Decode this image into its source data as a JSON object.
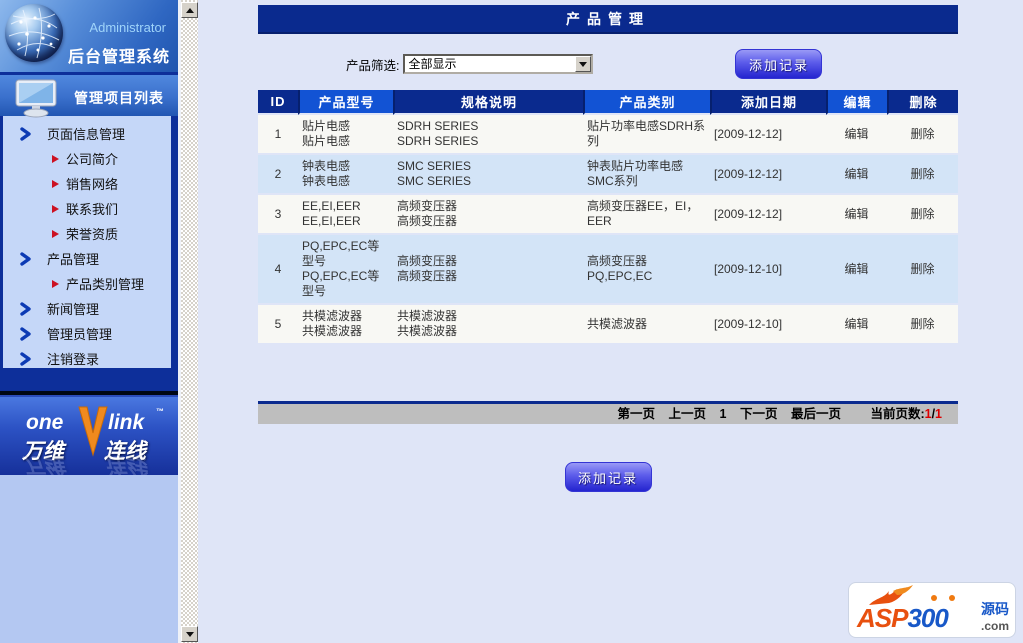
{
  "colors": {
    "accent_navy": "#0a2a8e",
    "accent_blue": "#1253d4",
    "button_blue": "#2424cf",
    "row_alt_blue": "#d3e4f7",
    "page_count_red": "#dd0000"
  },
  "sidebar": {
    "admin_label": "Administrator",
    "system_title": "后台管理系统",
    "menu_title": "管理项目列表",
    "items": [
      {
        "label": "页面信息管理"
      },
      {
        "label": "公司简介"
      },
      {
        "label": "销售网络"
      },
      {
        "label": "联系我们"
      },
      {
        "label": "荣誉资质"
      },
      {
        "label": "产品管理"
      },
      {
        "label": "产品类别管理"
      },
      {
        "label": "新闻管理"
      },
      {
        "label": "管理员管理"
      },
      {
        "label": "注销登录"
      }
    ],
    "logo": {
      "one": "one",
      "link": "link",
      "tm": "™",
      "cn1": "万维",
      "cn2": "连线"
    }
  },
  "header": {
    "title": "产品管理"
  },
  "filter": {
    "label": "产品筛选:",
    "selected": "全部显示"
  },
  "buttons": {
    "add_record": "添加记录"
  },
  "table": {
    "columns": [
      "ID",
      "产品型号",
      "规格说明",
      "产品类别",
      "添加日期",
      "编辑",
      "删除"
    ],
    "rows": [
      {
        "id": "1",
        "model": "贴片电感\n贴片电感",
        "spec": "SDRH SERIES\nSDRH SERIES",
        "category": "贴片功率电感SDRH系列",
        "date": "[2009-12-12]",
        "edit": "编辑",
        "delete": "删除"
      },
      {
        "id": "2",
        "model": "钟表电感\n钟表电感",
        "spec": "SMC SERIES\nSMC SERIES",
        "category": "钟表贴片功率电感SMC系列",
        "date": "[2009-12-12]",
        "edit": "编辑",
        "delete": "删除"
      },
      {
        "id": "3",
        "model": "EE,EI,EER\nEE,EI,EER",
        "spec": "高频变压器\n高频变压器",
        "category": "高频变压器EE，EI，EER",
        "date": "[2009-12-12]",
        "edit": "编辑",
        "delete": "删除"
      },
      {
        "id": "4",
        "model": "PQ,EPC,EC等型号\nPQ,EPC,EC等型号",
        "spec": "高频变压器\n高频变压器",
        "category": "高频变压器PQ,EPC,EC",
        "date": "[2009-12-10]",
        "edit": "编辑",
        "delete": "删除"
      },
      {
        "id": "5",
        "model": "共模滤波器\n共模滤波器",
        "spec": "共模滤波器\n共模滤波器",
        "category": "共模滤波器",
        "date": "[2009-12-10]",
        "edit": "编辑",
        "delete": "删除"
      }
    ]
  },
  "pagination": {
    "first": "第一页",
    "prev": "上一页",
    "page": "1",
    "next": "下一页",
    "last": "最后一页",
    "current_label": "当前页数:",
    "current": "1",
    "sep": "/",
    "total": "1"
  },
  "footer_logo": {
    "asp": "ASP",
    "num": "300",
    "yuanma": "源码",
    "com": ".com"
  }
}
